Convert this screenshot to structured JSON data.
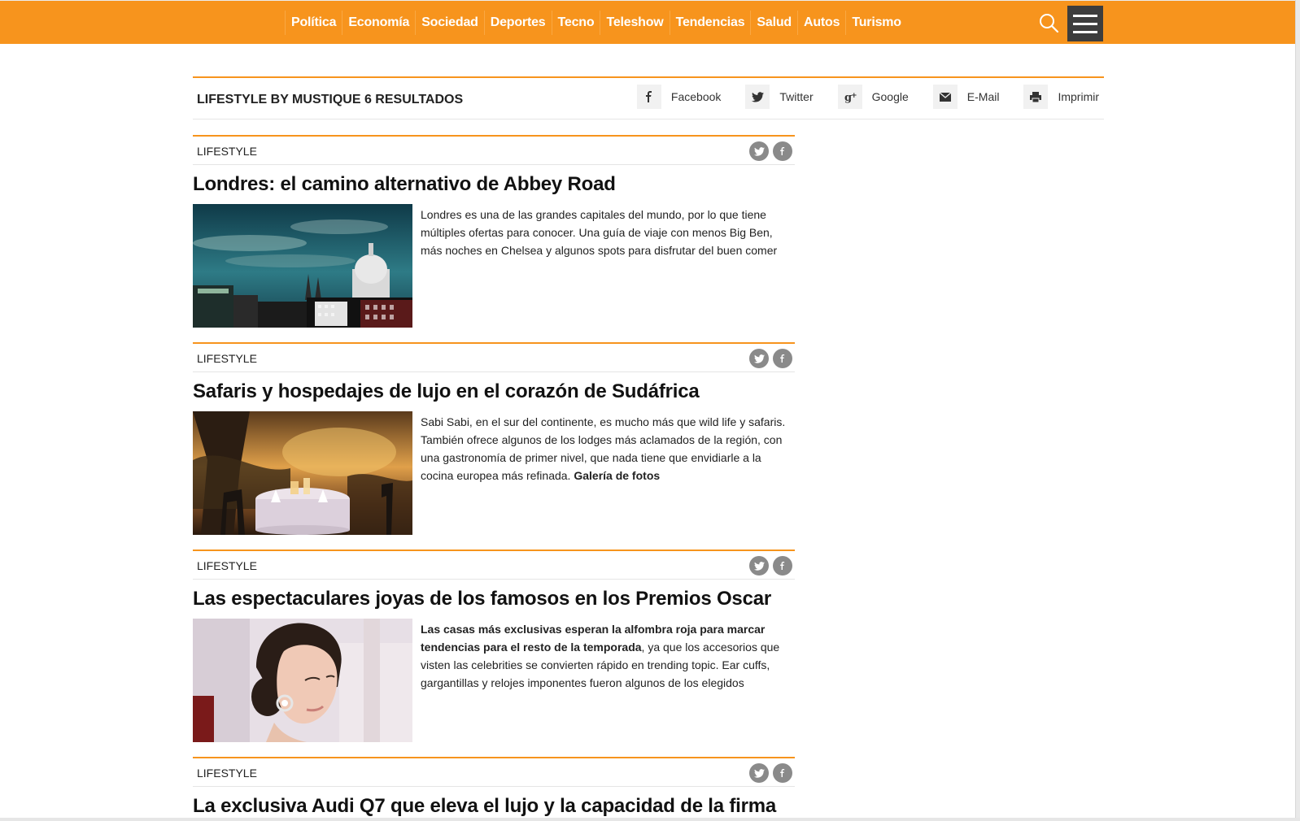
{
  "nav": {
    "items": [
      "Política",
      "Economía",
      "Sociedad",
      "Deportes",
      "Tecno",
      "Teleshow",
      "Tendencias",
      "Salud",
      "Autos",
      "Turismo"
    ]
  },
  "section": {
    "title": "LIFESTYLE BY MUSTIQUE 6 RESULTADOS",
    "share": {
      "facebook": "Facebook",
      "twitter": "Twitter",
      "google": "Google",
      "email": "E-Mail",
      "print": "Imprimir"
    }
  },
  "articles": [
    {
      "category": "LIFESTYLE",
      "title": "Londres: el camino alternativo de Abbey Road",
      "summary_bold": "",
      "summary": "Londres es una de las grandes capitales del mundo, por lo que tiene múltiples ofertas para conocer. Una guía de viaje con menos Big Ben, más noches en Chelsea y algunos spots para disfrutar del buen comer",
      "summary_link": ""
    },
    {
      "category": "LIFESTYLE",
      "title": "Safaris y hospedajes de lujo en el corazón de Sudáfrica",
      "summary_bold": "",
      "summary": "Sabi Sabi, en el sur del continente, es mucho más que wild life y safaris. También ofrece algunos de los lodges más aclamados de la región, con una gastronomía de primer nivel, que nada tiene que envidiarle a la cocina europea más refinada. ",
      "summary_link": "Galería de fotos"
    },
    {
      "category": "LIFESTYLE",
      "title": "Las espectaculares joyas de los famosos en los Premios Oscar",
      "summary_bold": "Las casas más exclusivas esperan la alfombra roja para marcar tendencias para el resto de la temporada",
      "summary": ", ya que los accesorios que visten las celebrities se convierten rápido en trending topic. Ear cuffs, gargantillas y relojes imponentes fueron algunos de los elegidos",
      "summary_link": ""
    },
    {
      "category": "LIFESTYLE",
      "title": "La exclusiva Audi Q7 que eleva el lujo y la capacidad de la firma",
      "summary_bold": "",
      "summary": "",
      "summary_link": ""
    }
  ],
  "colors": {
    "brand": "#f7941d",
    "menu": "#3d3d3d",
    "social": "#8a8a8a"
  },
  "icons": {
    "search": "search-icon",
    "menu": "hamburger-menu-icon",
    "twitter": "twitter-icon",
    "facebook": "facebook-icon",
    "google": "google-plus-icon",
    "email": "email-icon",
    "print": "print-icon"
  }
}
